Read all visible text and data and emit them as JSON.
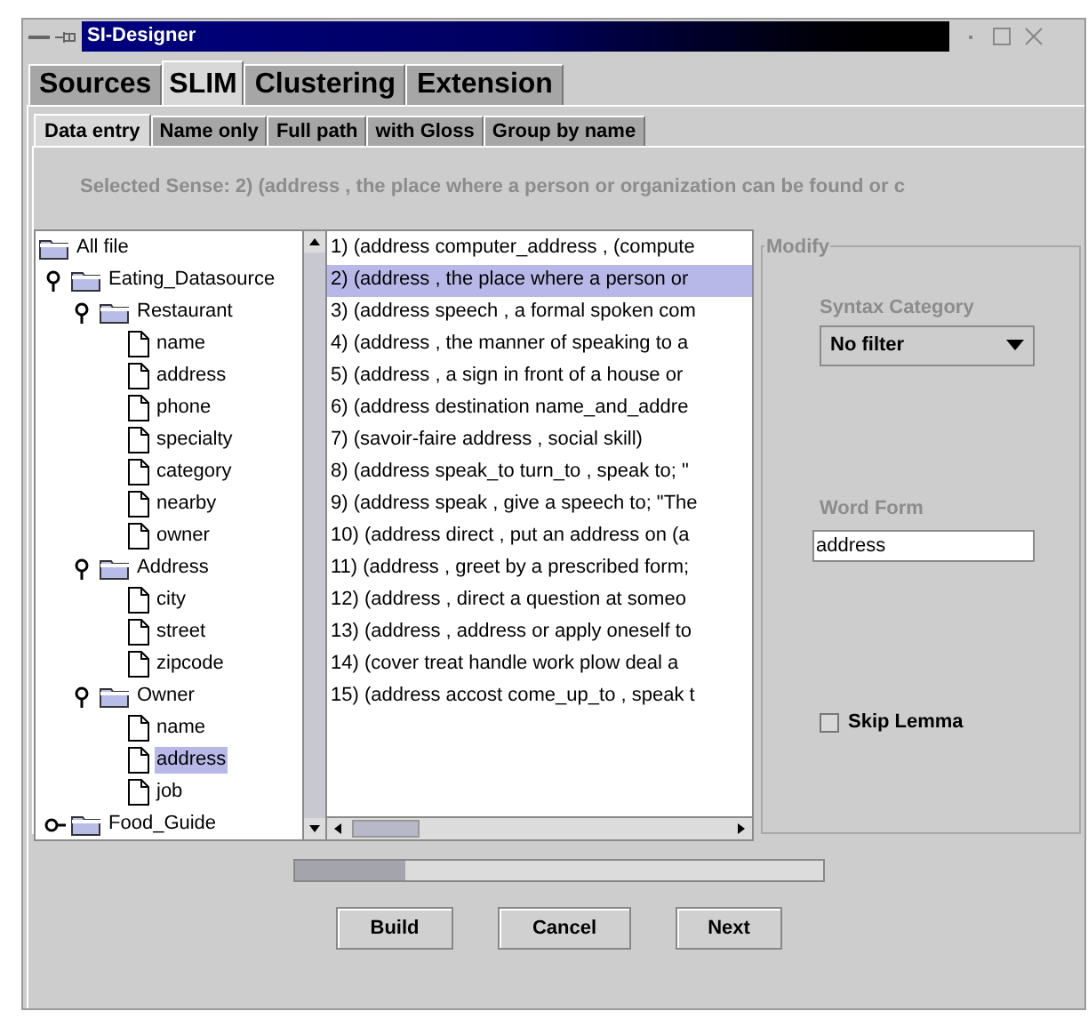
{
  "window": {
    "title": "SI-Designer"
  },
  "tabs": [
    {
      "label": "Sources",
      "selected": false
    },
    {
      "label": "SLIM",
      "selected": true
    },
    {
      "label": "Clustering",
      "selected": false
    },
    {
      "label": "Extension",
      "selected": false
    }
  ],
  "subtabs": [
    {
      "label": "Data entry",
      "selected": true
    },
    {
      "label": "Name only",
      "selected": false
    },
    {
      "label": "Full path",
      "selected": false
    },
    {
      "label": "with Gloss",
      "selected": false
    },
    {
      "label": "Group by name",
      "selected": false
    }
  ],
  "selected_sense": "Selected Sense: 2) (address , the place where a person or organization can be found or c",
  "tree": [
    {
      "label": "All file",
      "kind": "folder",
      "selected": false,
      "children": [
        {
          "label": "Eating_Datasource",
          "kind": "folder",
          "expanded": true,
          "selected": false,
          "children": [
            {
              "label": "Restaurant",
              "kind": "folder",
              "expanded": true,
              "selected": false,
              "children": [
                {
                  "label": "name",
                  "kind": "file",
                  "selected": false
                },
                {
                  "label": "address",
                  "kind": "file",
                  "selected": false
                },
                {
                  "label": "phone",
                  "kind": "file",
                  "selected": false
                },
                {
                  "label": "specialty",
                  "kind": "file",
                  "selected": false
                },
                {
                  "label": "category",
                  "kind": "file",
                  "selected": false
                },
                {
                  "label": "nearby",
                  "kind": "file",
                  "selected": false
                },
                {
                  "label": "owner",
                  "kind": "file",
                  "selected": false
                }
              ]
            },
            {
              "label": "Address",
              "kind": "folder",
              "expanded": true,
              "selected": false,
              "children": [
                {
                  "label": "city",
                  "kind": "file",
                  "selected": false
                },
                {
                  "label": "street",
                  "kind": "file",
                  "selected": false
                },
                {
                  "label": "zipcode",
                  "kind": "file",
                  "selected": false
                }
              ]
            },
            {
              "label": "Owner",
              "kind": "folder",
              "expanded": true,
              "selected": false,
              "children": [
                {
                  "label": "name",
                  "kind": "file",
                  "selected": false
                },
                {
                  "label": "address",
                  "kind": "file",
                  "selected": true
                },
                {
                  "label": "job",
                  "kind": "file",
                  "selected": false
                }
              ]
            }
          ]
        },
        {
          "label": "Food_Guide",
          "kind": "folder",
          "expanded": false,
          "selected": false
        }
      ]
    }
  ],
  "senses": [
    {
      "text": "1) (address computer_address , (compute",
      "selected": false
    },
    {
      "text": "2) (address , the place where a person or",
      "selected": true
    },
    {
      "text": "3) (address speech , a formal spoken com",
      "selected": false
    },
    {
      "text": "4) (address , the manner of speaking to a",
      "selected": false
    },
    {
      "text": "5) (address , a sign in front of a house or",
      "selected": false
    },
    {
      "text": "6) (address destination name_and_addre",
      "selected": false
    },
    {
      "text": "7) (savoir-faire address , social skill)",
      "selected": false
    },
    {
      "text": "8) (address speak_to turn_to , speak to; \"",
      "selected": false
    },
    {
      "text": "9) (address speak , give a speech to; \"The",
      "selected": false
    },
    {
      "text": "10) (address direct , put an address on (a",
      "selected": false
    },
    {
      "text": "11) (address , greet by a prescribed form;",
      "selected": false
    },
    {
      "text": "12) (address , direct a question at someo",
      "selected": false
    },
    {
      "text": "13) (address , address or apply oneself to",
      "selected": false
    },
    {
      "text": "14) (cover treat handle work plow deal a",
      "selected": false
    },
    {
      "text": "15) (address accost come_up_to , speak t",
      "selected": false
    }
  ],
  "modify": {
    "title": "Modify",
    "syntax_category": {
      "label": "Syntax Category",
      "value": "No filter"
    },
    "word_form": {
      "label": "Word Form",
      "value": "address"
    },
    "skip_lemma": {
      "label": "Skip Lemma",
      "checked": false
    }
  },
  "progress": {
    "level": 0.21
  },
  "buttons": [
    "Build",
    "Cancel",
    "Next"
  ]
}
